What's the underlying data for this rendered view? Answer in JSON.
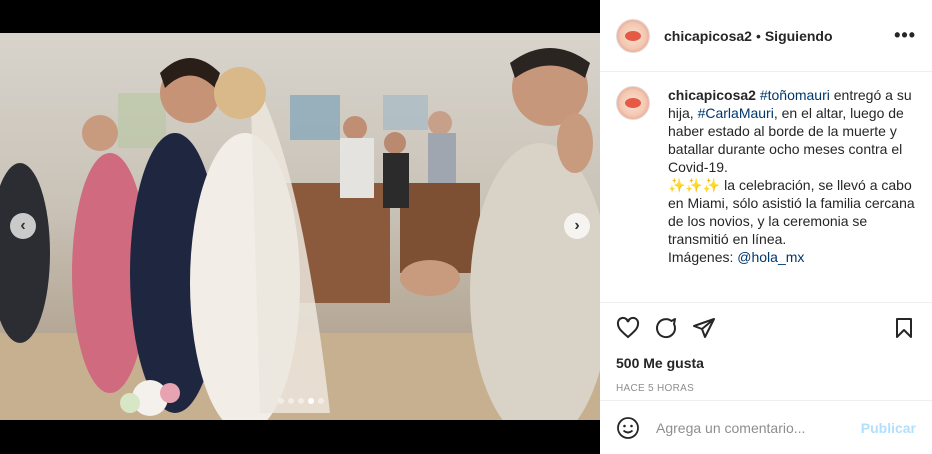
{
  "post": {
    "username": "chicapicosa2",
    "separator": "•",
    "follow_status": "Siguiendo",
    "more": "•••"
  },
  "caption": {
    "username": "chicapicosa2",
    "mention1": "#toñomauri",
    "text1": " entregó a su hija, ",
    "mention2": "#CarlaMauri",
    "text2": ", en el altar, luego de haber estado al borde de la muerte y batallar durante ocho meses contra el Covid-19.",
    "sparkles": "✨✨✨",
    "text3": " la celebración, se llevó a cabo en Miami, sólo asistió la familia cercana de los novios, y la ceremonia se transmitió en línea.",
    "images_label": "Imágenes: ",
    "images_handle": "@hola_mx"
  },
  "stats": {
    "likes": "500 Me gusta",
    "time": "HACE 5 HORAS"
  },
  "comment": {
    "placeholder": "Agrega un comentario...",
    "post_label": "Publicar"
  },
  "media": {
    "prev": "‹",
    "next": "›",
    "total_slides": 5,
    "active_slide": 4
  },
  "icons": [
    "smiley-icon",
    "heart-icon",
    "comment-icon",
    "share-icon",
    "bookmark-icon",
    "more-icon"
  ]
}
